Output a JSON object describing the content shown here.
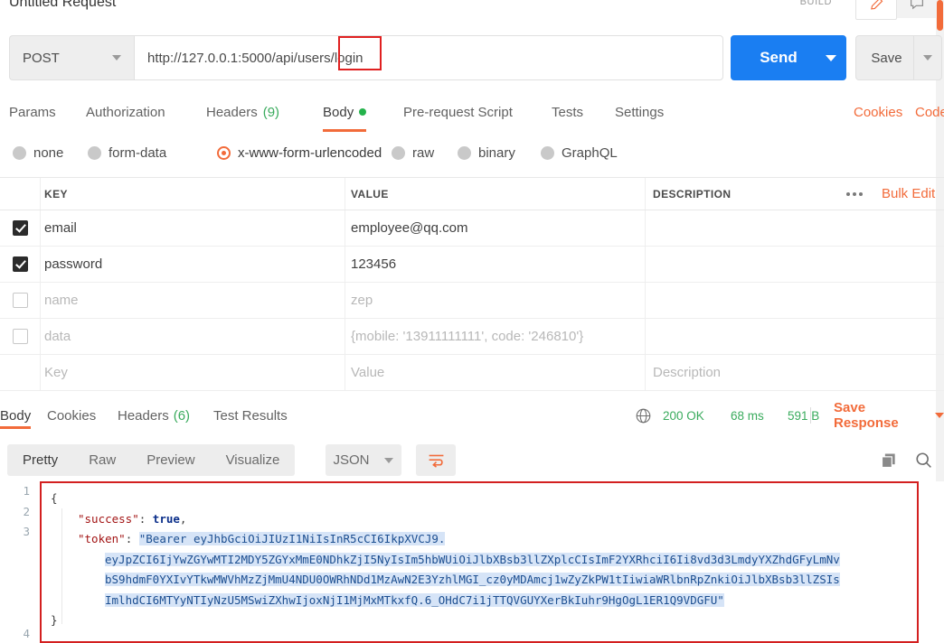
{
  "window": {
    "request_title": "Untitled Request",
    "build_label": "BUILD",
    "pencil_icon": "pencil-icon",
    "comment_icon": "comment-icon"
  },
  "url_bar": {
    "method": "POST",
    "url": "http://127.0.0.1:5000/api/users/login",
    "highlighted_fragment": "/login",
    "send_label": "Send",
    "save_label": "Save"
  },
  "request_tabs": [
    {
      "label": "Params",
      "count": "",
      "active": false,
      "dot": false
    },
    {
      "label": "Authorization",
      "count": "",
      "active": false,
      "dot": false
    },
    {
      "label": "Headers",
      "count": "(9)",
      "active": false,
      "dot": false
    },
    {
      "label": "Body",
      "count": "",
      "active": true,
      "dot": true
    },
    {
      "label": "Pre-request Script",
      "count": "",
      "active": false,
      "dot": false
    },
    {
      "label": "Tests",
      "count": "",
      "active": false,
      "dot": false
    },
    {
      "label": "Settings",
      "count": "",
      "active": false,
      "dot": false
    }
  ],
  "right_links": {
    "cookies": "Cookies",
    "code": "Code"
  },
  "body_types": [
    {
      "label": "none",
      "selected": false
    },
    {
      "label": "form-data",
      "selected": false
    },
    {
      "label": "x-www-form-urlencoded",
      "selected": true
    },
    {
      "label": "raw",
      "selected": false
    },
    {
      "label": "binary",
      "selected": false
    },
    {
      "label": "GraphQL",
      "selected": false
    }
  ],
  "kv_table": {
    "headers": {
      "key": "KEY",
      "value": "VALUE",
      "description": "DESCRIPTION"
    },
    "more_icon": "ellipsis-icon",
    "bulk_edit_label": "Bulk Edit",
    "rows": [
      {
        "checked": true,
        "key": "email",
        "value": "employee@qq.com",
        "description": "",
        "placeholder": false
      },
      {
        "checked": true,
        "key": "password",
        "value": "123456",
        "description": "",
        "placeholder": false
      },
      {
        "checked": false,
        "key": "name",
        "value": "zep",
        "description": "",
        "placeholder": false
      },
      {
        "checked": false,
        "key": "data",
        "value": "{mobile: '13911111111', code: '246810'}",
        "description": "",
        "placeholder": false
      },
      {
        "checked": false,
        "key": "Key",
        "value": "Value",
        "description": "Description",
        "placeholder": true
      }
    ]
  },
  "response_tabs": [
    {
      "label": "Body",
      "count": "",
      "active": true
    },
    {
      "label": "Cookies",
      "count": "",
      "active": false
    },
    {
      "label": "Headers",
      "count": "(6)",
      "active": false
    },
    {
      "label": "Test Results",
      "count": "",
      "active": false
    }
  ],
  "response_meta": {
    "globe_icon": "globe-icon",
    "status": "200 OK",
    "time": "68 ms",
    "size": "591 B",
    "save_response_label": "Save Response"
  },
  "view_bar": {
    "views": [
      {
        "label": "Pretty",
        "active": true
      },
      {
        "label": "Raw",
        "active": false
      },
      {
        "label": "Preview",
        "active": false
      },
      {
        "label": "Visualize",
        "active": false
      }
    ],
    "format": "JSON",
    "wrap_icon": "word-wrap-icon",
    "copy_icon": "copy-icon",
    "search_icon": "search-icon"
  },
  "json_body": {
    "line_numbers": [
      "1",
      "2",
      "3",
      "4"
    ],
    "open_brace": "{",
    "close_brace": "}",
    "success_key": "\"success\"",
    "success_sep": ": ",
    "success_value": "true",
    "success_comma": ",",
    "token_key": "\"token\"",
    "token_sep": ": ",
    "token_lines": [
      "\"Bearer eyJhbGciOiJIUzI1NiIsInR5cCI6IkpXVCJ9.",
      "eyJpZCI6IjYwZGYwMTI2MDY5ZGYxMmE0NDhkZjI5NyIsIm5hbWUiOiJlbXBsb3llZXplcCIsImF2YXRhciI6Ii8vd3d3LmdyYXZhdGFyLmNv",
      "bS9hdmF0YXIvYTkwMWVhMzZjMmU4NDU0OWRhNDd1MzAwN2E3YzhlMGI_cz0yMDAmcj1wZyZkPW1tIiwiaWRlbnRpZnkiOiJlbXBsb3llZSIs",
      "ImlhdCI6MTYyNTIyNzU5MSwiZXhwIjoxNjI1MjMxMTkxfQ.6_OHdC7i1jTTQVGUYXerBkIuhr9HgOgL1ER1Q9VDGFU\""
    ]
  }
}
